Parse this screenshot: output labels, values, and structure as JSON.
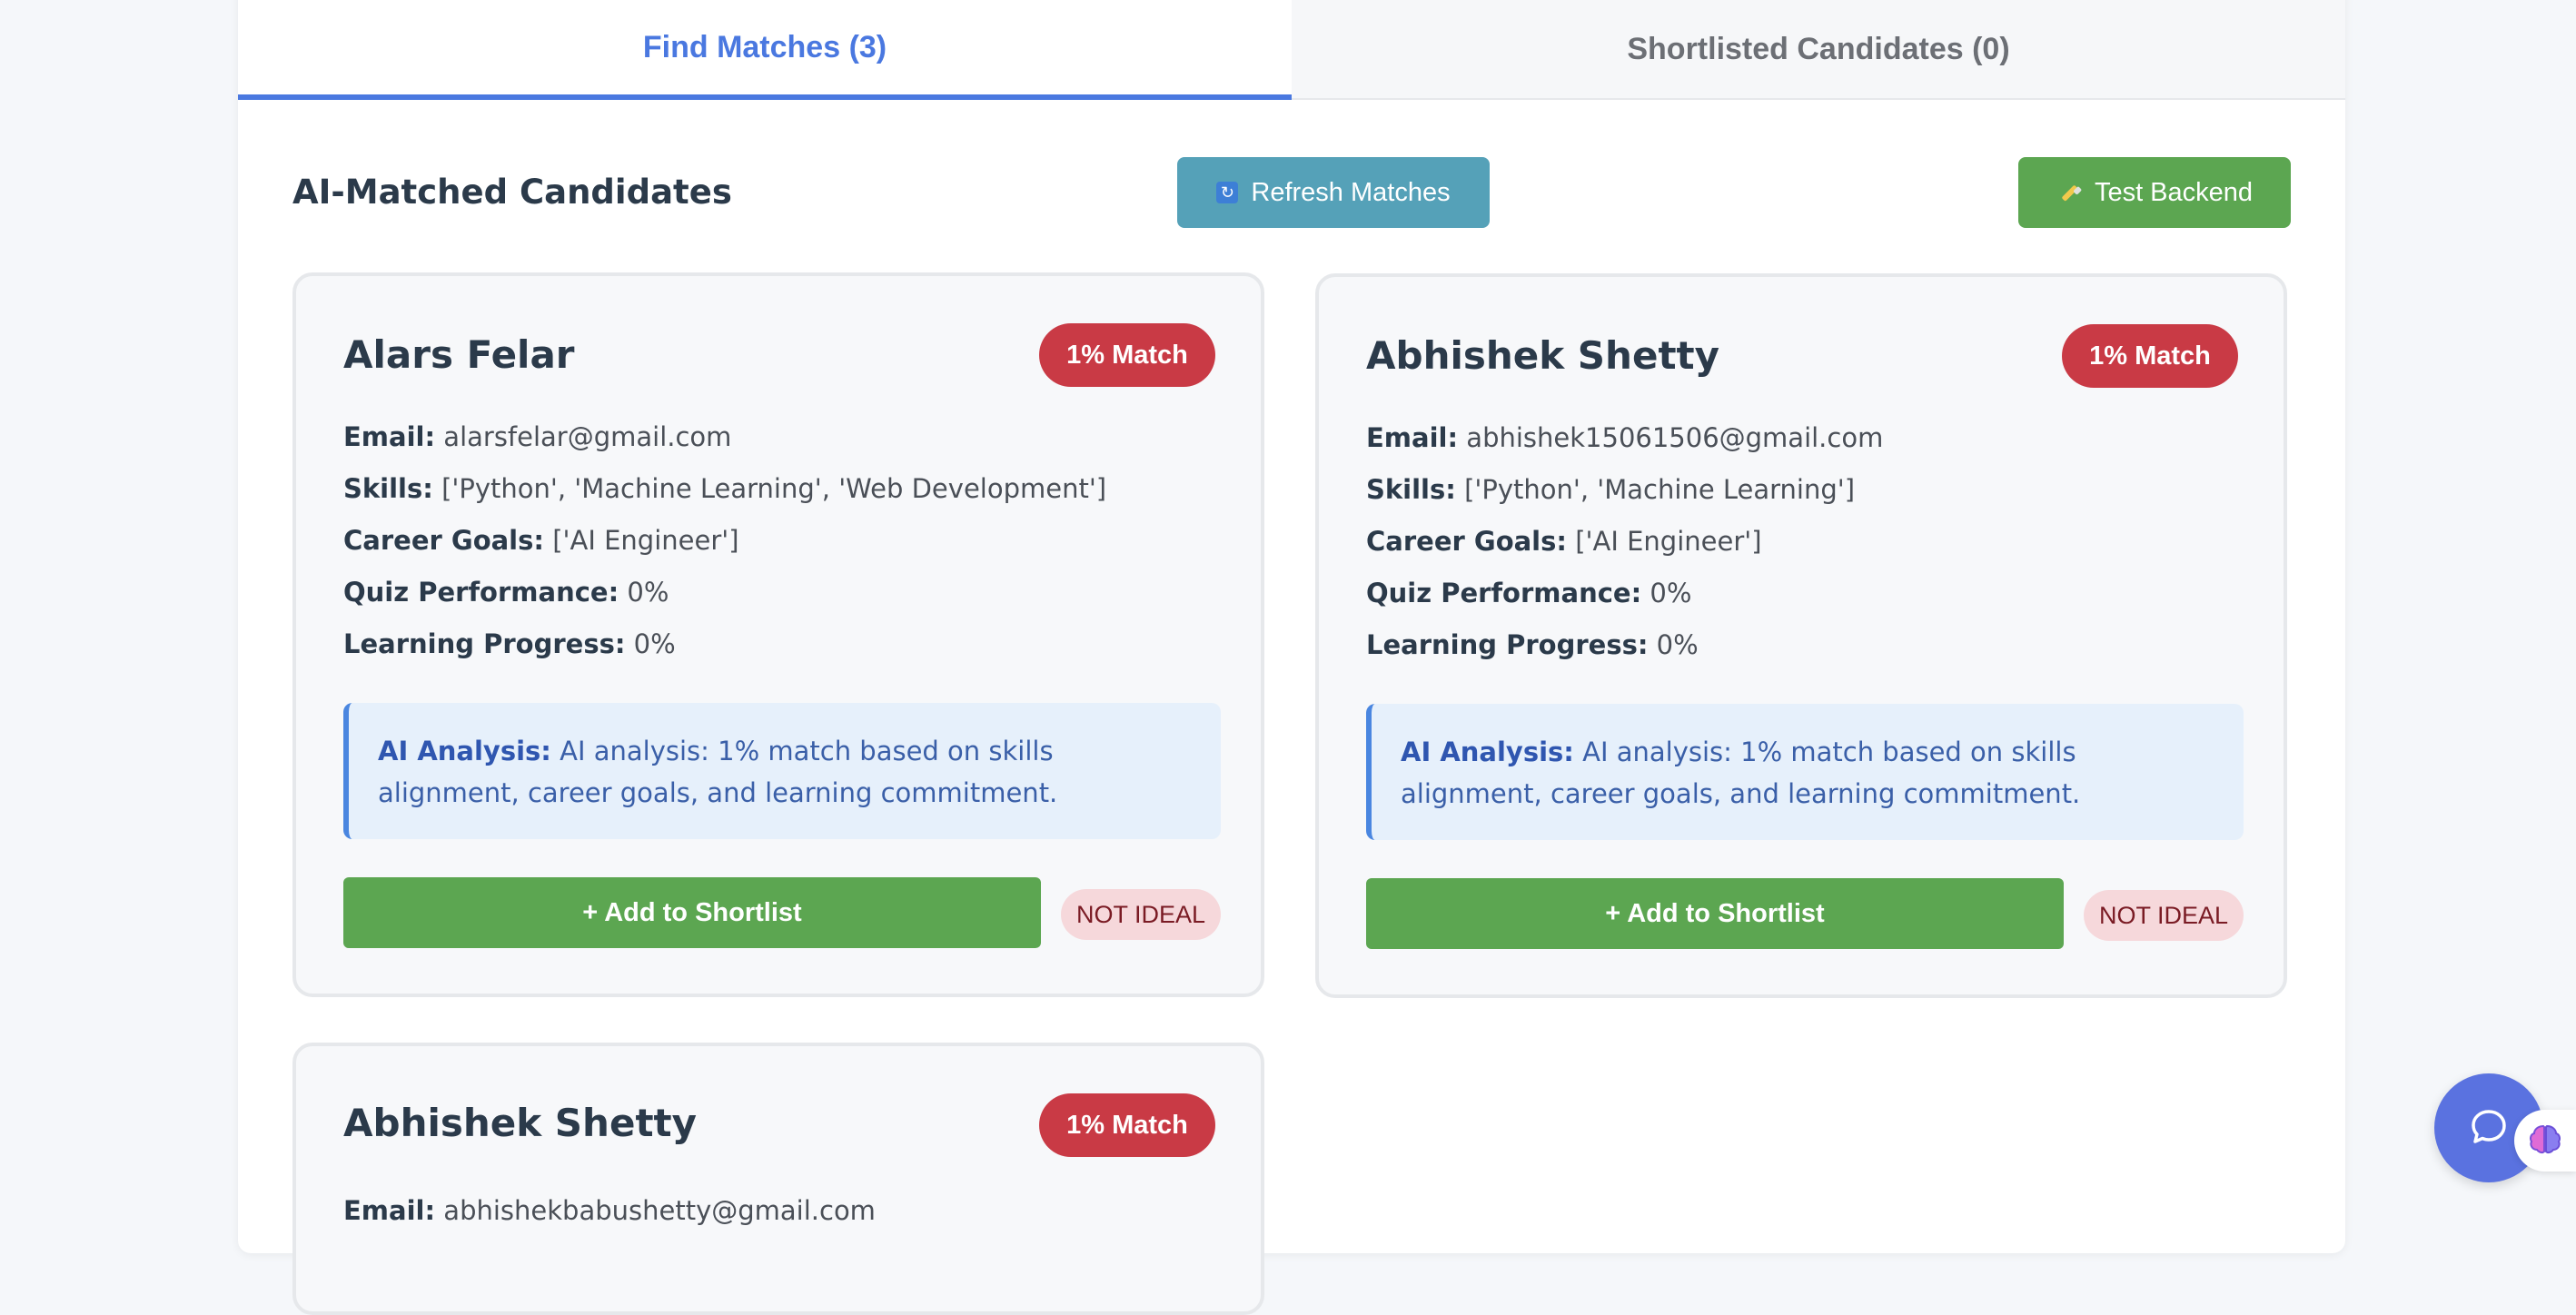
{
  "tabs": {
    "find_label": "Find Matches (3)",
    "shortlisted_label": "Shortlisted Candidates (0)"
  },
  "section": {
    "title": "AI-Matched Candidates",
    "refresh_label": "Refresh Matches",
    "test_label": "Test Backend"
  },
  "labels": {
    "email": "Email:",
    "skills": "Skills:",
    "career_goals": "Career Goals:",
    "quiz": "Quiz Performance:",
    "progress": "Learning Progress:",
    "analysis": "AI Analysis:"
  },
  "candidates": [
    {
      "name": "Alars Felar",
      "match": "1% Match",
      "email": "alarsfelar@gmail.com",
      "skills": "['Python', 'Machine Learning', 'Web Development']",
      "career_goals": "['AI Engineer']",
      "quiz": "0%",
      "progress": "0%",
      "analysis": "AI analysis: 1% match based on skills alignment, career goals, and learning commitment.",
      "add_label": "+ Add to Shortlist",
      "status": "NOT IDEAL"
    },
    {
      "name": "Abhishek Shetty",
      "match": "1% Match",
      "email": "abhishek15061506@gmail.com",
      "skills": "['Python', 'Machine Learning']",
      "career_goals": "['AI Engineer']",
      "quiz": "0%",
      "progress": "0%",
      "analysis": "AI analysis: 1% match based on skills alignment, career goals, and learning commitment.",
      "add_label": "+ Add to Shortlist",
      "status": "NOT IDEAL"
    },
    {
      "name": "Abhishek Shetty",
      "match": "1% Match",
      "email": "abhishekbabushetty@gmail.com"
    }
  ],
  "colors": {
    "accent": "#4a78e0",
    "match_badge": "#c93a45",
    "add_button": "#5ca651",
    "refresh_button": "#55a1b8"
  },
  "icons": {
    "refresh": "refresh-icon",
    "test": "wrench-icon",
    "chat": "chat-icon",
    "brain": "brain-icon"
  }
}
